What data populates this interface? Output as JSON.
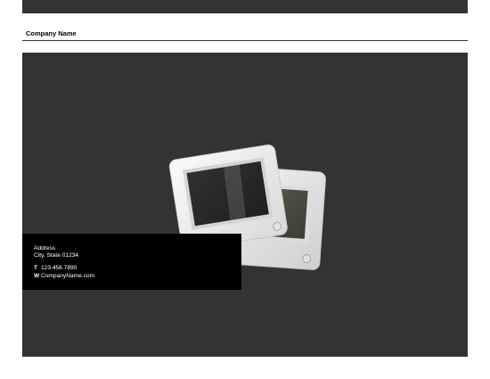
{
  "header": {
    "company_name": "Company Name"
  },
  "contact": {
    "address": "Address",
    "city_state": "City, State 01234",
    "phone_key": "T",
    "phone": "123.456.7890",
    "web_key": "W",
    "web": "CompanyName.com"
  },
  "colors": {
    "panel": "#333333",
    "info_box": "#000000",
    "slide_frame": "#e9e9e9"
  },
  "illustration": {
    "icon": "photo-slides-icon"
  }
}
